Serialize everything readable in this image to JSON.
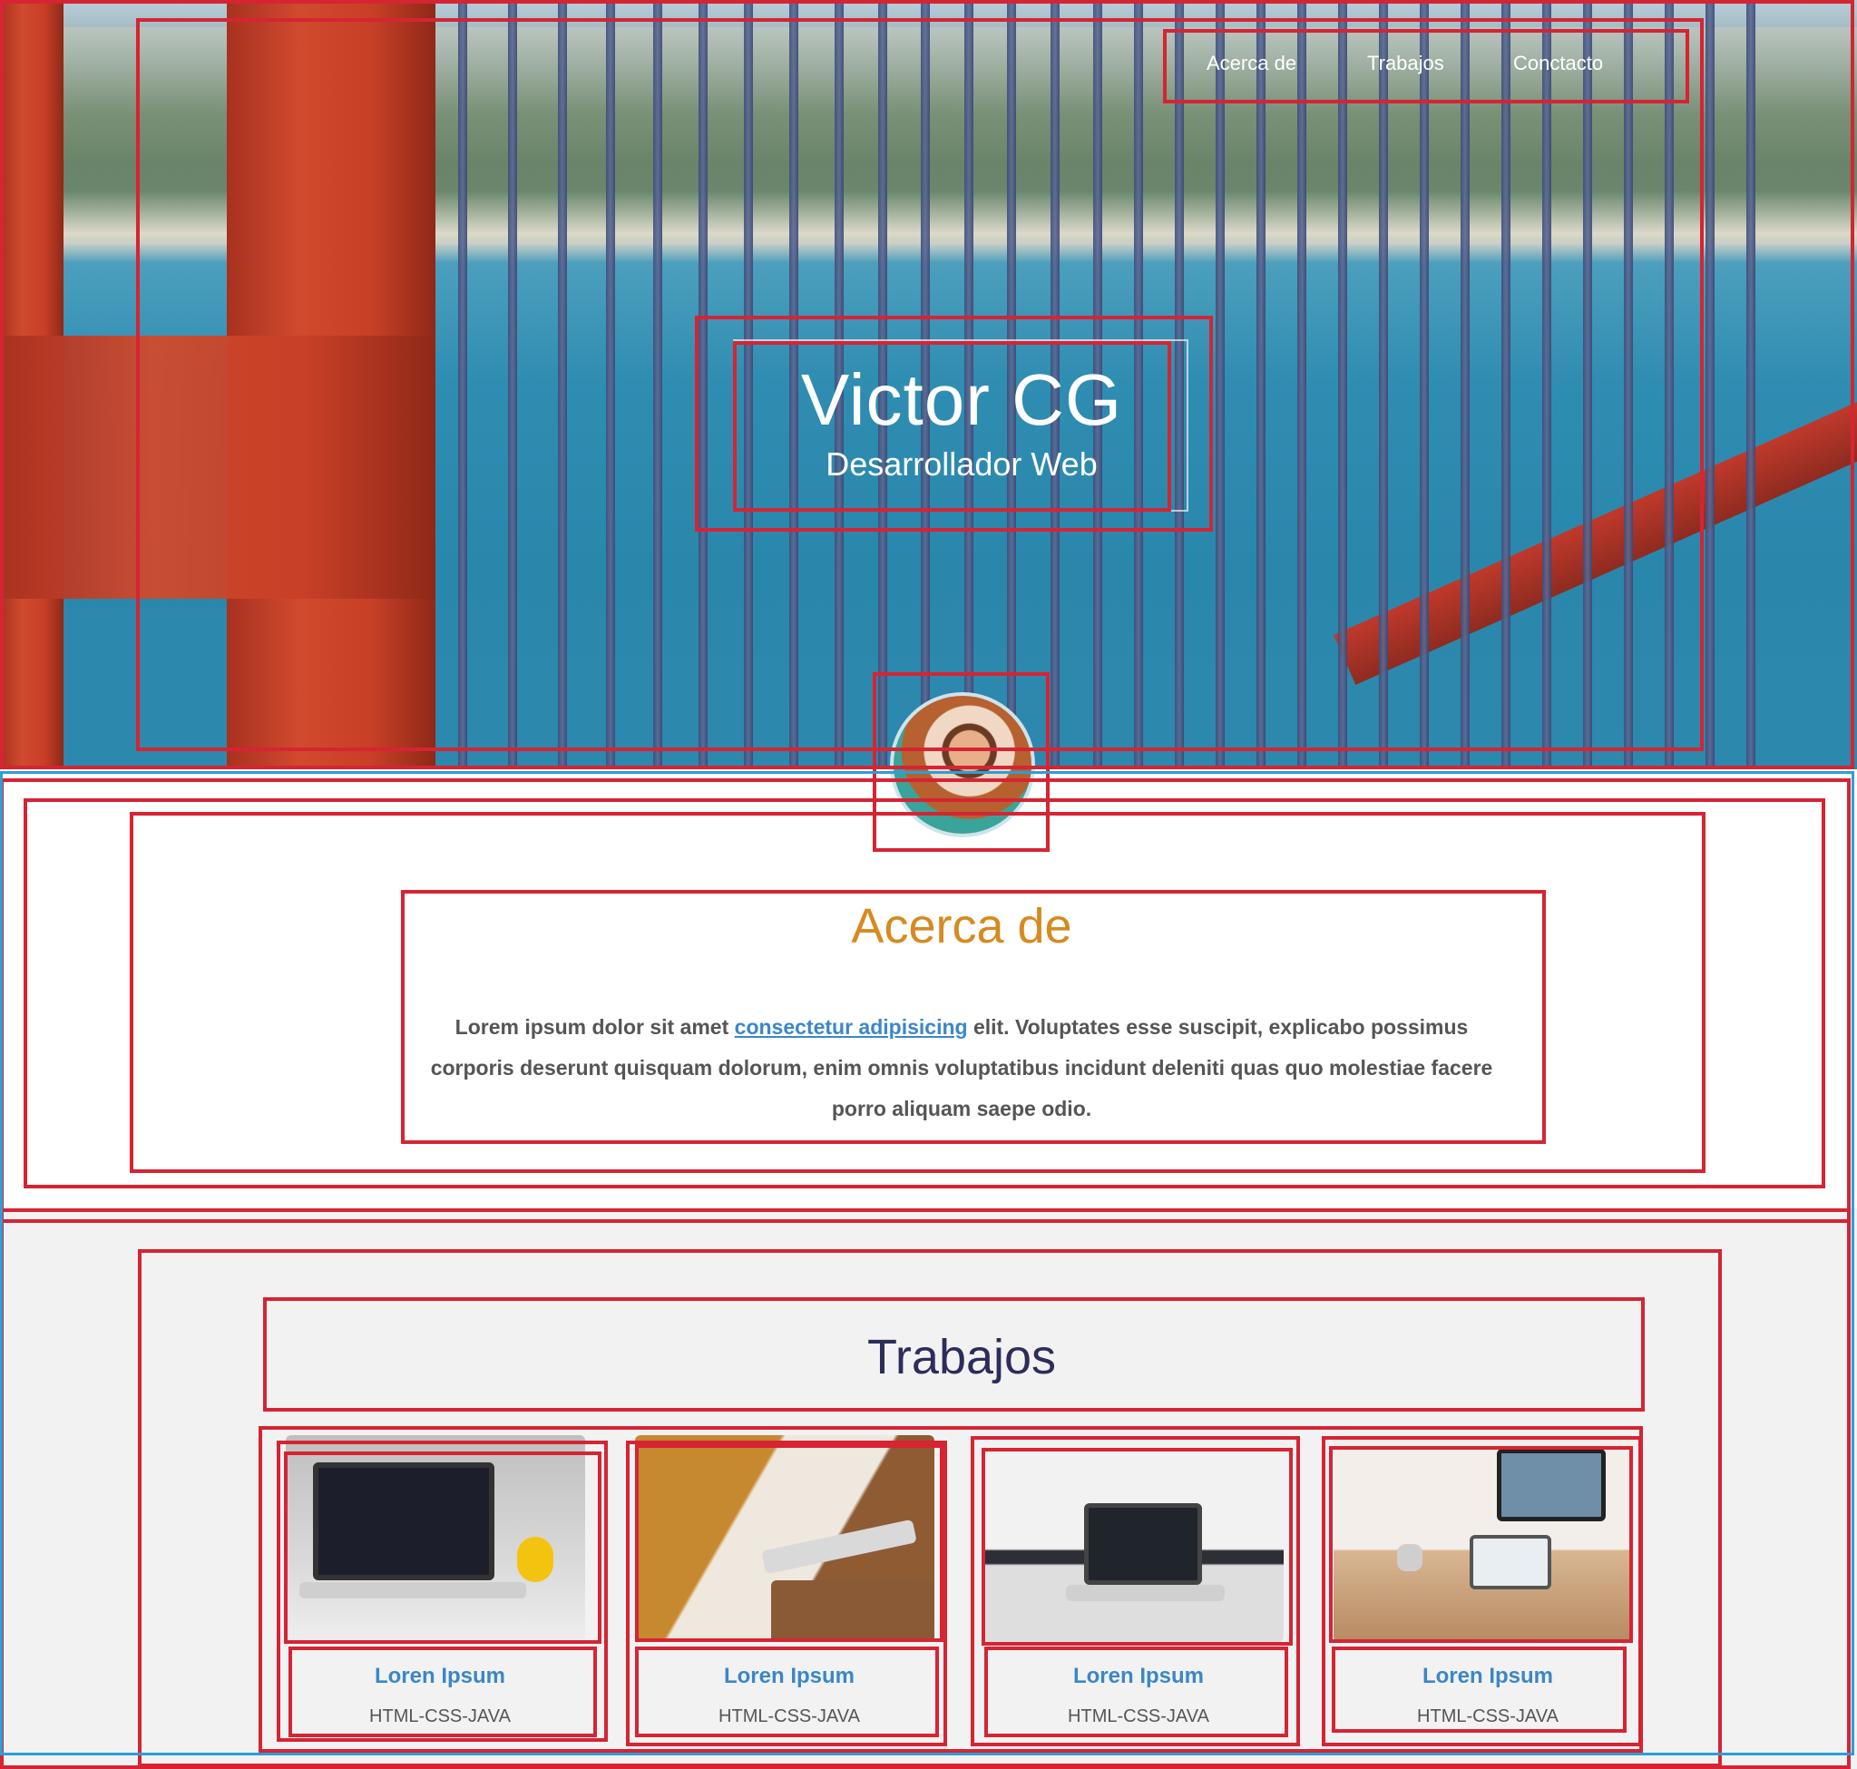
{
  "nav": {
    "items": [
      {
        "label": "Acerca de"
      },
      {
        "label": "Trabajos"
      },
      {
        "label": "Conctacto"
      }
    ]
  },
  "hero": {
    "title": "Victor CG",
    "subtitle": "Desarrollador Web"
  },
  "about": {
    "title": "Acerca de",
    "text_before": "Lorem ipsum dolor sit amet ",
    "link": "consectetur adipisicing",
    "text_after": " elit. Voluptates esse suscipit, explicabo possimus corporis deserunt quisquam dolorum, enim omnis voluptatibus incidunt deleniti quas quo molestiae facere porro aliquam saepe odio."
  },
  "works": {
    "title": "Trabajos",
    "items": [
      {
        "title": "Loren Ipsum",
        "tech": "HTML-CSS-JAVA"
      },
      {
        "title": "Loren Ipsum",
        "tech": "HTML-CSS-JAVA"
      },
      {
        "title": "Loren Ipsum",
        "tech": "HTML-CSS-JAVA"
      },
      {
        "title": "Loren Ipsum",
        "tech": "HTML-CSS-JAVA"
      }
    ]
  },
  "colors": {
    "overlay_red": "#d62433",
    "overlay_blue": "#2a9fd8",
    "about_title": "#d68a1f",
    "works_title": "#2c2d5b",
    "link": "#3a87c8"
  }
}
